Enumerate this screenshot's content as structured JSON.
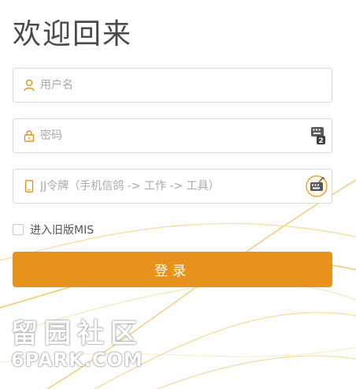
{
  "title": "欢迎回来",
  "fields": {
    "username": {
      "placeholder": "用户名",
      "icon": "user-icon"
    },
    "password": {
      "placeholder": "密码",
      "icon": "lock-icon",
      "trail_icon": "keyboard-icon",
      "trail_badge": "2"
    },
    "token": {
      "placeholder": "JJ令牌（手机信鸽 -> 工作 -> 工具）",
      "icon": "phone-icon",
      "trail_icon": "token-icon"
    }
  },
  "legacy_checkbox": {
    "label": "进入旧版MIS",
    "checked": false
  },
  "login_button": {
    "label": "登录"
  },
  "watermark": {
    "text_cn": "留园社区",
    "text_en": "6PARK.COM"
  },
  "colors": {
    "accent": "#e8921e",
    "icon": "#e8921e",
    "wave": "#f2c25a"
  }
}
